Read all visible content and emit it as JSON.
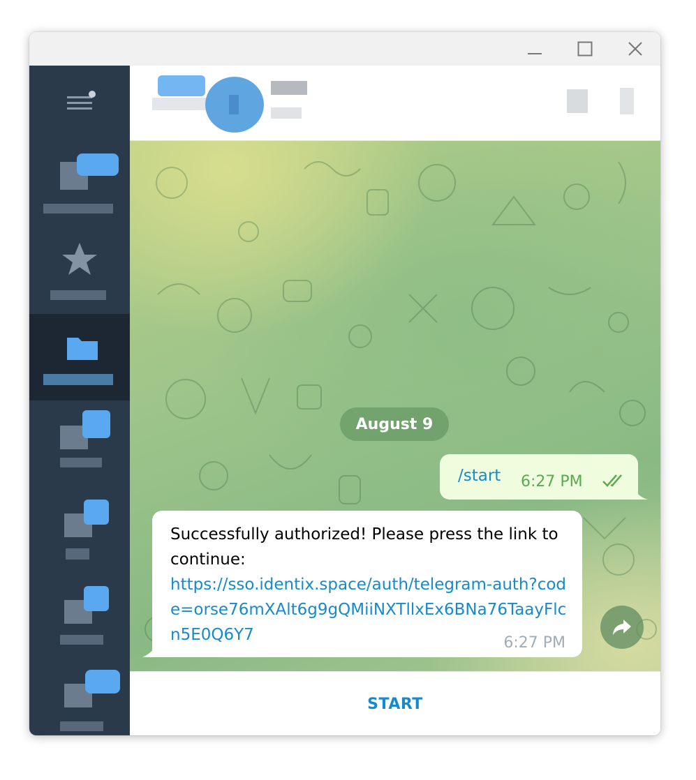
{
  "window": {
    "controls": {
      "minimize_icon": "minimize-icon",
      "maximize_icon": "maximize-icon",
      "close_icon": "close-icon"
    }
  },
  "sidebar": {
    "menu_icon": "menu-icon",
    "items": [
      {
        "icon": "all-chats-folder-icon",
        "active": false
      },
      {
        "icon": "star-folder-icon",
        "active": false
      },
      {
        "icon": "folder-icon",
        "active": true
      },
      {
        "icon": "chat-folder-icon",
        "active": false
      },
      {
        "icon": "chat-folder-icon",
        "active": false
      },
      {
        "icon": "chat-folder-icon",
        "active": false
      },
      {
        "icon": "chat-folder-icon",
        "active": false
      }
    ]
  },
  "header": {
    "search_icon": "search-icon",
    "more_icon": "more-vertical-icon"
  },
  "messages": {
    "date_separator": "August 9",
    "outgoing": {
      "text": "/start",
      "time": "6:27 PM",
      "status_icon": "double-check-icon"
    },
    "incoming": {
      "text": "Successfully authorized! Please press the link to continue:",
      "link": "https://sso.identix.space/auth/telegram-auth?code=orse76mXAlt6g9gQMiiNXTllxEx6BNa76TaayFlcn5E0Q6Y7",
      "time": "6:27 PM"
    },
    "forward_icon": "forward-icon"
  },
  "bottom": {
    "start_label": "START"
  },
  "colors": {
    "sidebar_bg": "#2b3a4b",
    "sidebar_active": "#1c2733",
    "accent": "#168acd",
    "out_bubble": "#effdde",
    "out_time": "#5ca853"
  }
}
